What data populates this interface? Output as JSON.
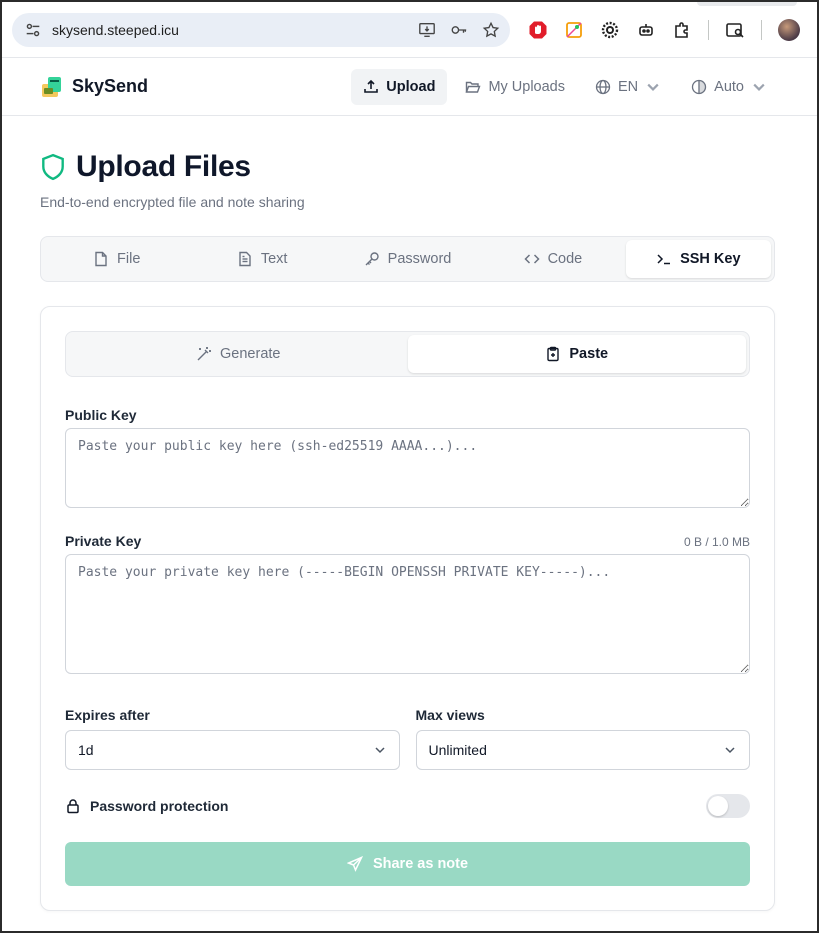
{
  "browser": {
    "url": "skysend.steeped.icu"
  },
  "app": {
    "brand_name": "SkySend",
    "nav": {
      "upload": "Upload",
      "my_uploads": "My Uploads",
      "language": "EN",
      "theme": "Auto"
    }
  },
  "page": {
    "title": "Upload Files",
    "subtitle": "End-to-end encrypted file and note sharing",
    "tabs": [
      {
        "label": "File",
        "icon": "file-icon"
      },
      {
        "label": "Text",
        "icon": "text-file-icon"
      },
      {
        "label": "Password",
        "icon": "key-icon"
      },
      {
        "label": "Code",
        "icon": "code-icon"
      },
      {
        "label": "SSH Key",
        "icon": "terminal-icon",
        "active": true
      }
    ]
  },
  "form": {
    "subtabs": [
      {
        "label": "Generate",
        "icon": "magic-wand-icon"
      },
      {
        "label": "Paste",
        "icon": "clipboard-icon",
        "active": true
      }
    ],
    "public_key": {
      "label": "Public Key",
      "value": "",
      "placeholder": "Paste your public key here (ssh-ed25519 AAAA...)..."
    },
    "private_key": {
      "label": "Private Key",
      "counter": "0 B / 1.0 MB",
      "value": "",
      "placeholder": "Paste your private key here (-----BEGIN OPENSSH PRIVATE KEY-----)..."
    },
    "expires": {
      "label": "Expires after",
      "value": "1d"
    },
    "max_views": {
      "label": "Max views",
      "value": "Unlimited"
    },
    "password_protection": {
      "label": "Password protection",
      "enabled": false
    },
    "submit_label": "Share as note"
  },
  "colors": {
    "accent": "#10b981",
    "accent_disabled": "#99d9c4"
  }
}
